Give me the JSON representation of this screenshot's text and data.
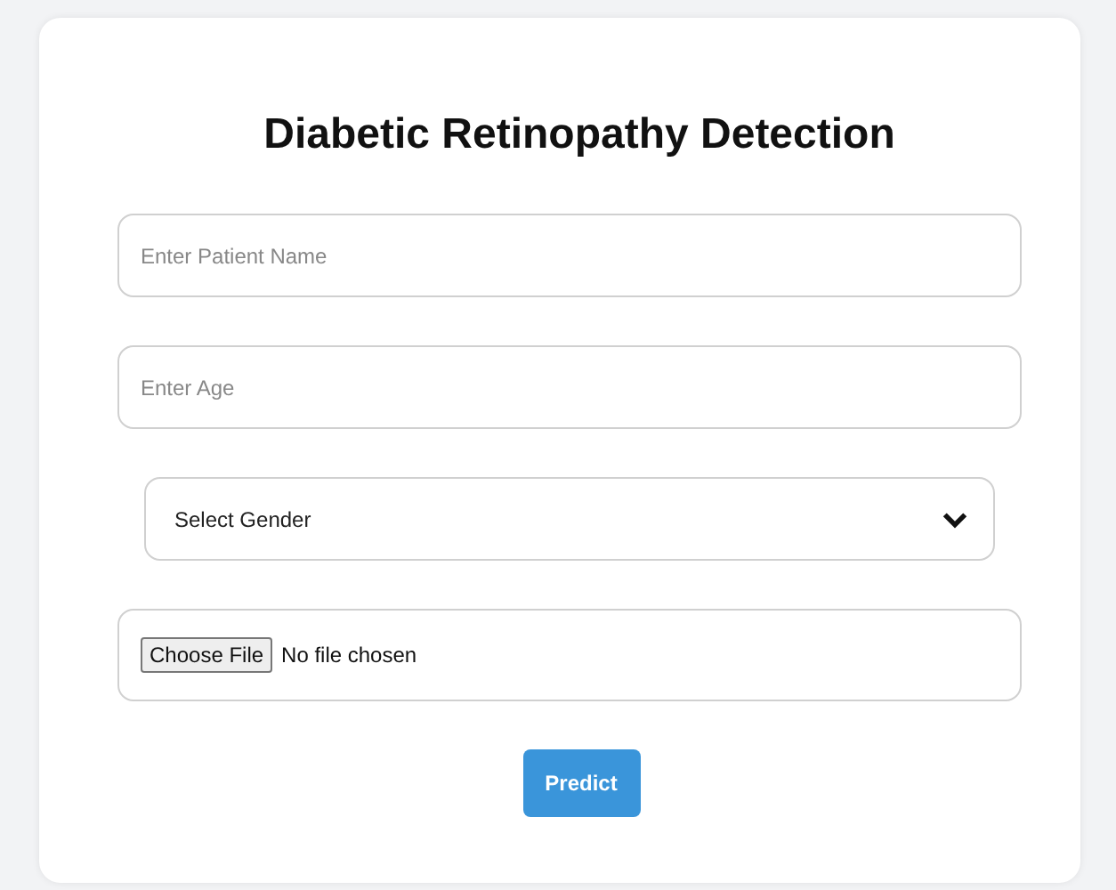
{
  "form": {
    "title": "Diabetic Retinopathy Detection",
    "fields": [
      {
        "kind": "text",
        "placeholder": "Enter Patient Name"
      },
      {
        "kind": "text",
        "placeholder": "Enter Age"
      },
      {
        "kind": "select",
        "value": "Select Gender"
      },
      {
        "kind": "file",
        "button": "Choose File",
        "status": "No file chosen"
      }
    ],
    "submit": "Predict"
  }
}
